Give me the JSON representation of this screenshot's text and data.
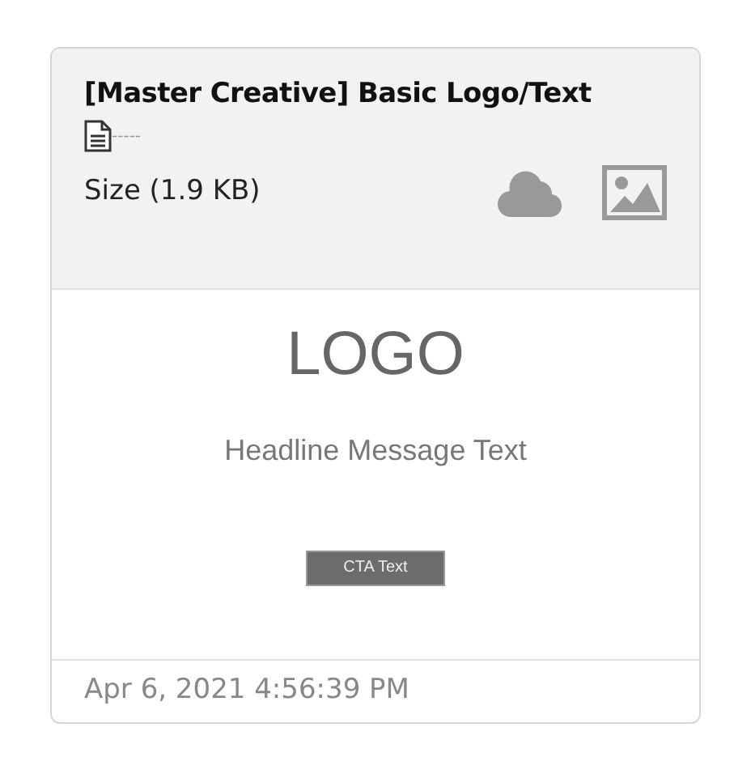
{
  "card": {
    "title": "[Master Creative] Basic Logo/Text",
    "file_dashes": "-----",
    "size": "Size (1.9 KB)"
  },
  "preview": {
    "logo": "LOGO",
    "headline": "Headline Message Text",
    "cta": "CTA Text"
  },
  "footer": {
    "timestamp": "Apr 6, 2021 4:56:39 PM"
  }
}
